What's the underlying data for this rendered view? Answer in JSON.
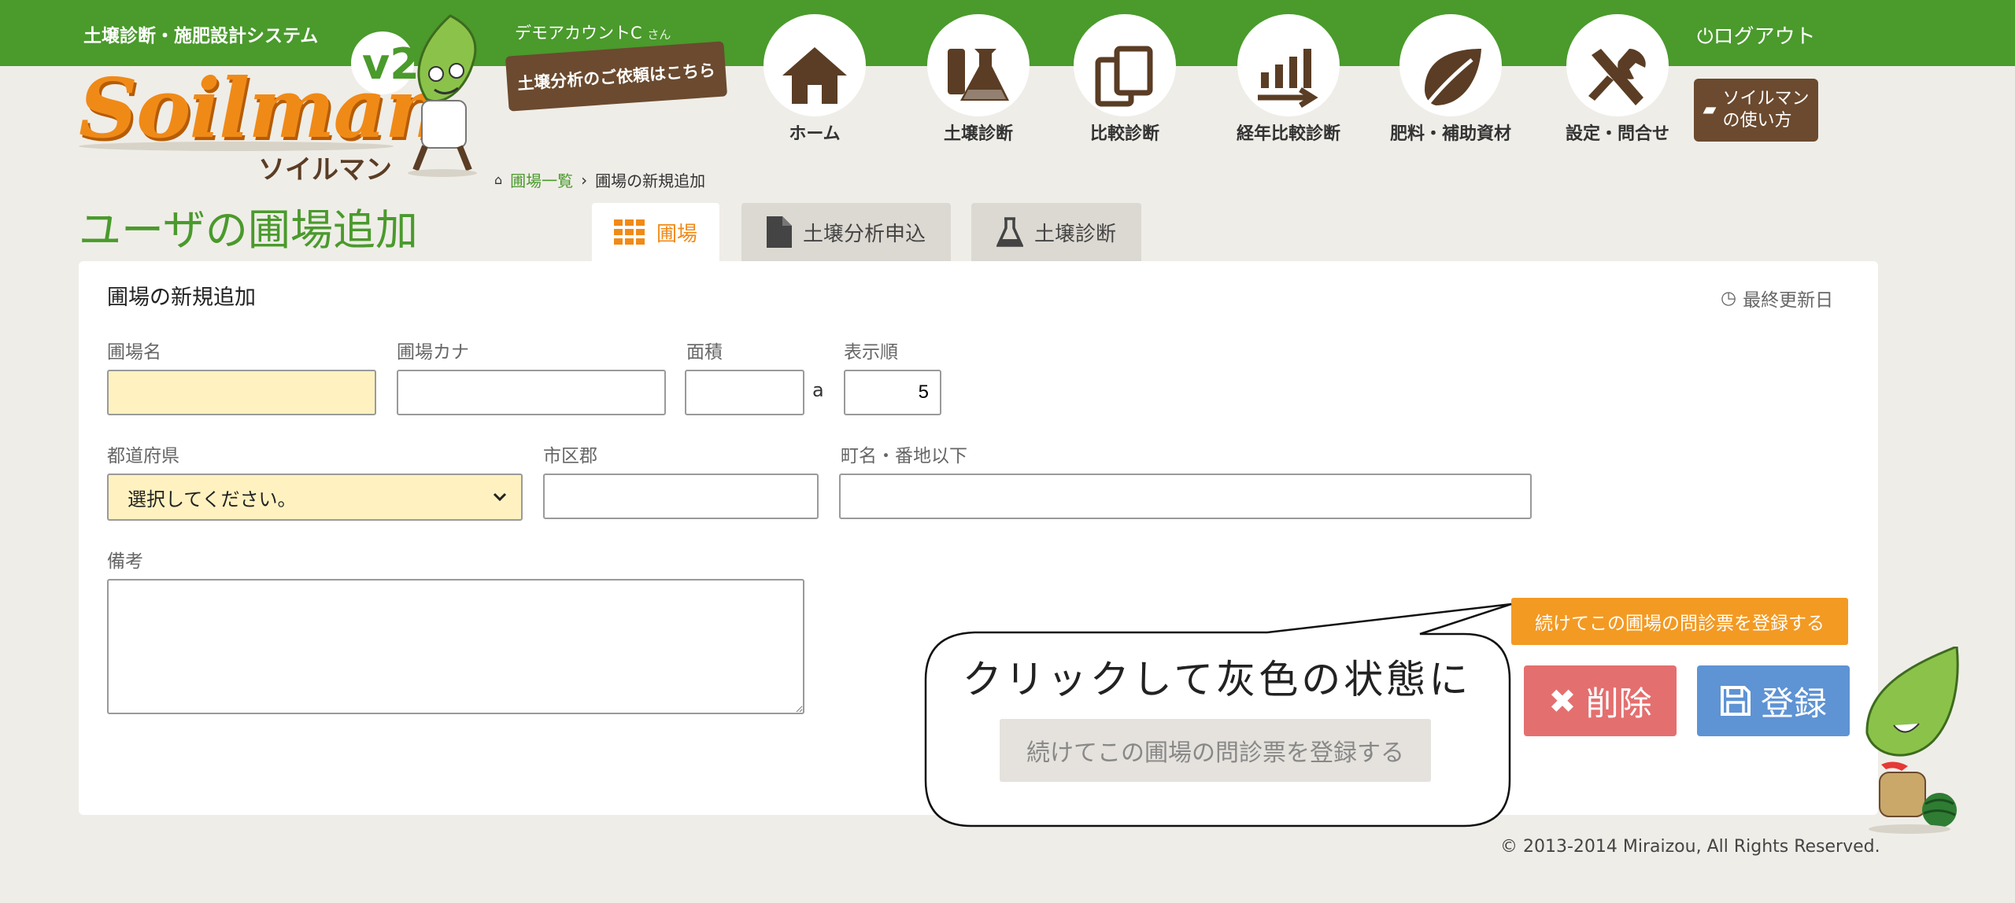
{
  "header": {
    "system_title": "土壌診断・施肥設計システム",
    "logo_text": "Soilman",
    "logo_registered": "®",
    "logo_kana": "ソイルマン",
    "version": "v2",
    "account_name": "デモアカウントC",
    "account_suffix": "さん",
    "request_banner": "土壌分析のご依頼はこちら",
    "logout": "ログアウト",
    "guide_line1": "ソイルマン",
    "guide_line2": "の使い方"
  },
  "nav": {
    "home": "ホーム",
    "soil_diagnosis": "土壌診断",
    "compare": "比較診断",
    "yearly_compare": "経年比較診断",
    "fertilizer": "肥料・補助資材",
    "settings": "設定・問合せ"
  },
  "breadcrumb": {
    "list": "圃場一覧",
    "separator": "›",
    "current": "圃場の新規追加"
  },
  "page": {
    "title": "ユーザの圃場追加"
  },
  "tabs": {
    "field": "圃場",
    "soil_request": "土壌分析申込",
    "soil_diagnosis": "土壌診断"
  },
  "form": {
    "panel_title": "圃場の新規追加",
    "last_updated": "最終更新日",
    "field_name_label": "圃場名",
    "field_name_value": "",
    "field_kana_label": "圃場カナ",
    "field_kana_value": "",
    "area_label": "面積",
    "area_value": "",
    "area_unit": "a",
    "order_label": "表示順",
    "order_value": "5",
    "prefecture_label": "都道府県",
    "prefecture_selected": "選択してください。",
    "city_label": "市区郡",
    "city_value": "",
    "address_label": "町名・番地以下",
    "address_value": "",
    "notes_label": "備考",
    "notes_value": ""
  },
  "actions": {
    "continue_register": "続けてこの圃場の問診票を登録する",
    "delete": "削除",
    "save": "登録"
  },
  "annotation": {
    "text": "クリックして灰色の状態に",
    "grey_button": "続けてこの圃場の問診票を登録する"
  },
  "footer": {
    "copyright": "© 2013-2014 Miraizou, All Rights Reserved."
  },
  "colors": {
    "brand_green": "#4a9a2c",
    "brand_orange": "#f08a17",
    "brown": "#6b4a2f",
    "required_field": "#fff2c0",
    "delete_red": "#e46f6f",
    "save_blue": "#5e93d4"
  }
}
